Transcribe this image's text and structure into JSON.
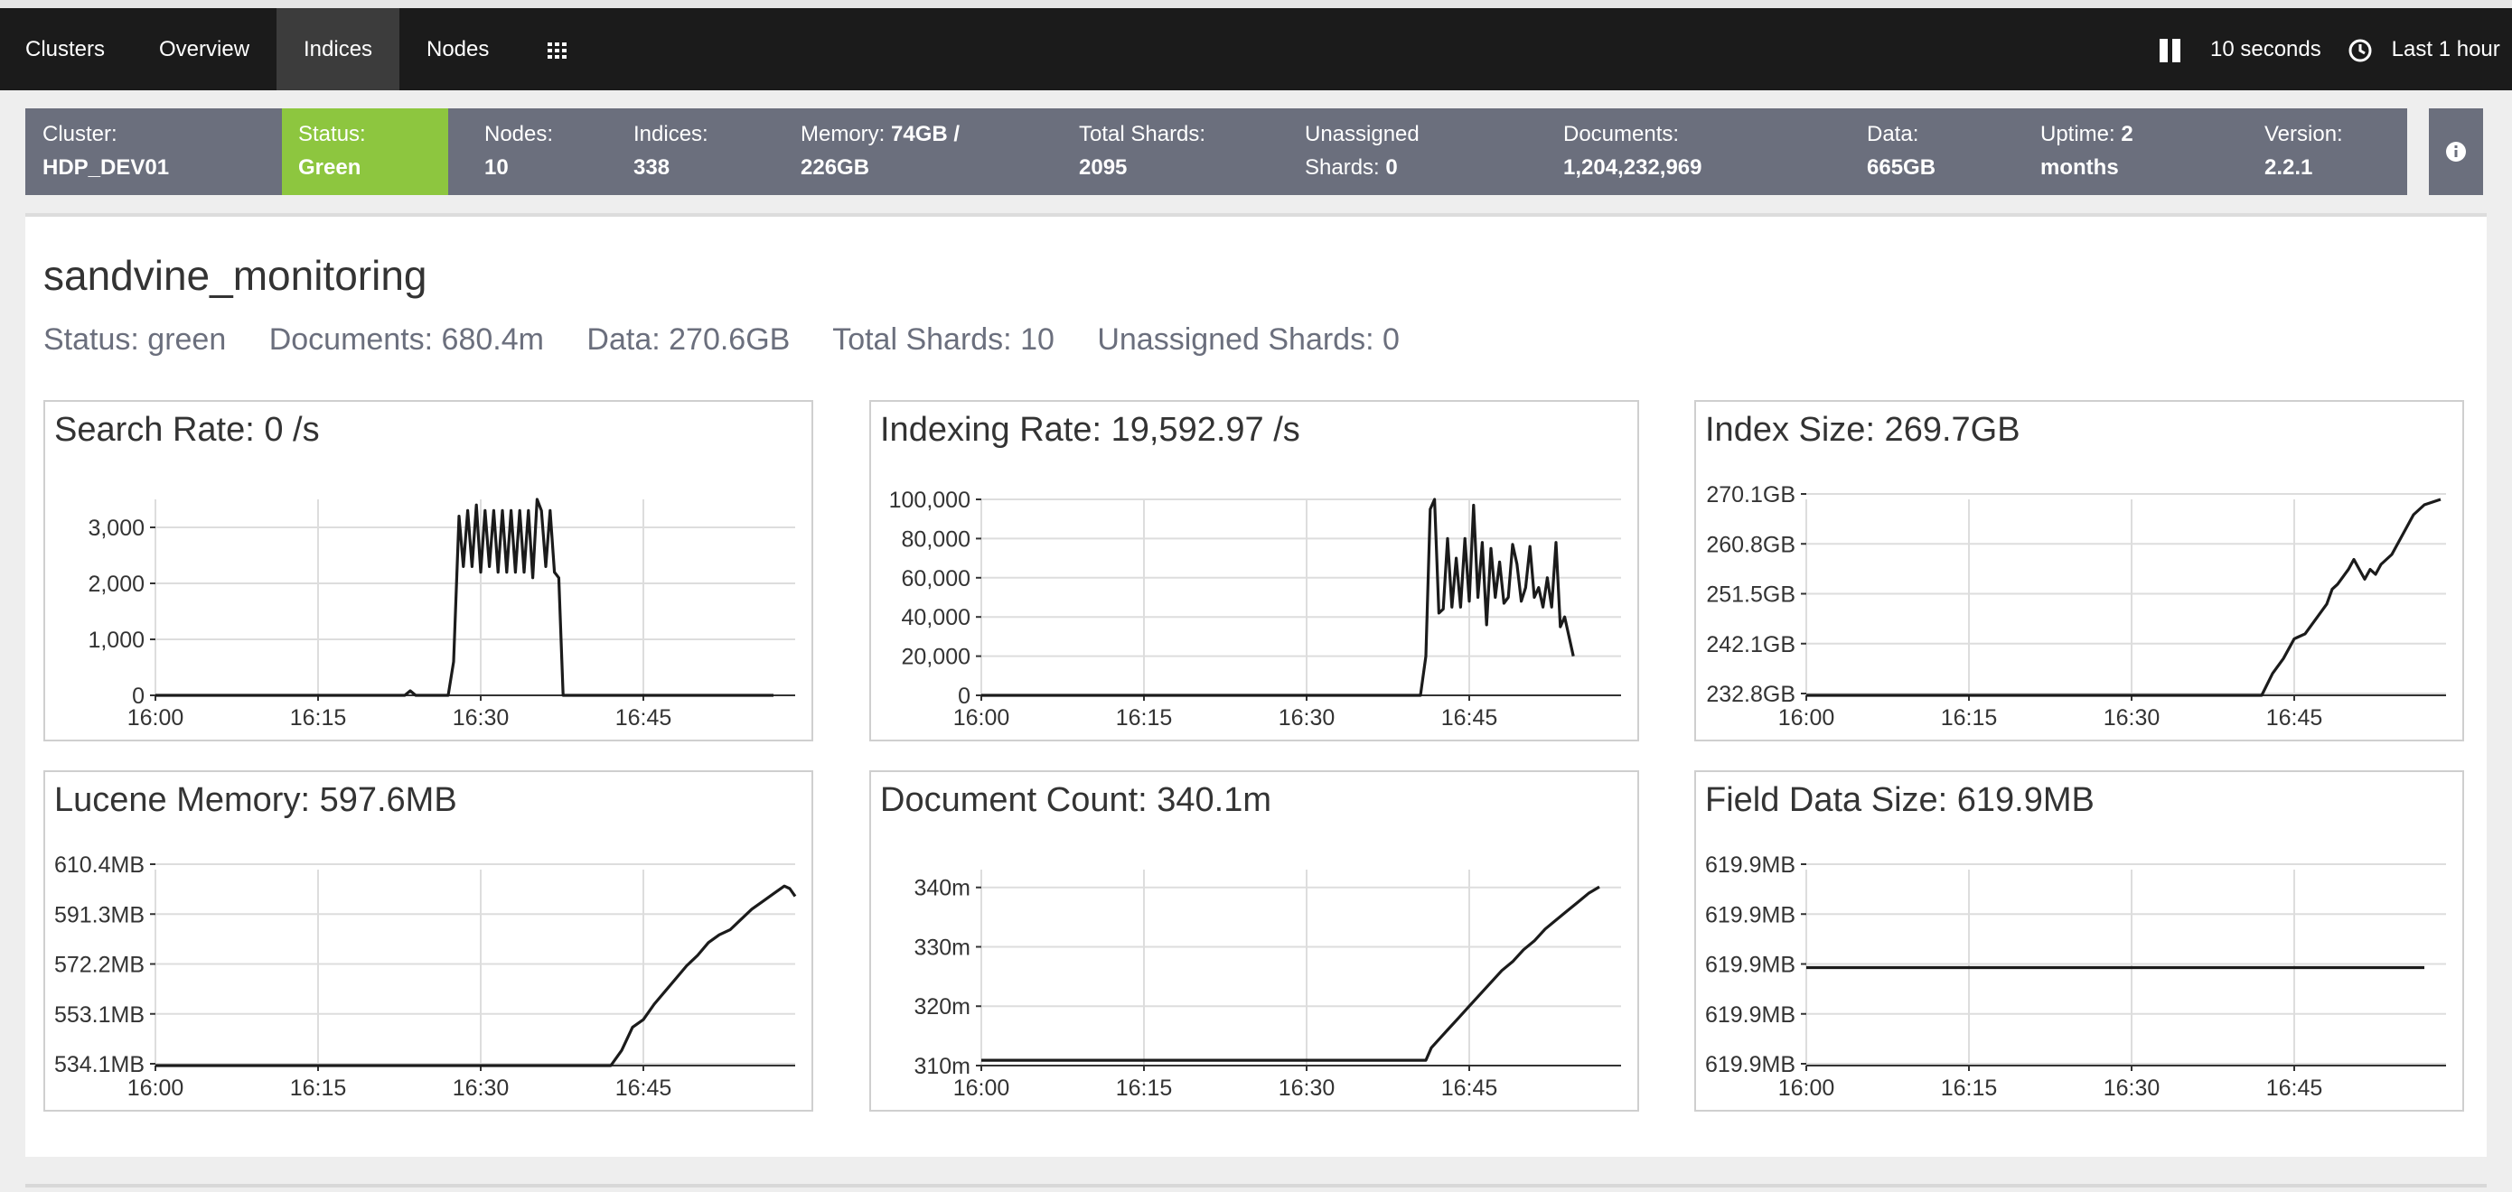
{
  "nav": {
    "tabs": [
      {
        "label": "Clusters"
      },
      {
        "label": "Overview"
      },
      {
        "label": "Indices",
        "active": true
      },
      {
        "label": "Nodes"
      }
    ],
    "grid_icon": "grid-icon",
    "refresh_label": "10 seconds",
    "time_label": "Last 1 hour",
    "pause_icon": "pause-icon",
    "clock_icon": "clock-icon"
  },
  "summary": {
    "cluster_label": "Cluster:",
    "cluster_value": "HDP_DEV01",
    "status_label": "Status:",
    "status_value": "Green",
    "nodes_label": "Nodes:",
    "nodes_value": "10",
    "indices_label": "Indices:",
    "indices_value": "338",
    "memory_label": "Memory:",
    "memory_value_line1": "74GB /",
    "memory_value_line2": "226GB",
    "shards_label": "Total Shards:",
    "shards_value": "2095",
    "unassigned_label_line1": "Unassigned",
    "unassigned_label_line2": "Shards:",
    "unassigned_value": "0",
    "documents_label": "Documents:",
    "documents_value": "1,204,232,969",
    "data_label": "Data:",
    "data_value": "665GB",
    "uptime_label": "Uptime:",
    "uptime_value_line1": "2",
    "uptime_value_line2": "months",
    "version_label": "Version:",
    "version_value": "2.2.1",
    "info_icon": "info-icon",
    "status_color": "#8dc63f",
    "bar_color": "#6b6f7d"
  },
  "index": {
    "name": "sandvine_monitoring",
    "status": "Status: green",
    "documents": "Documents: 680.4m",
    "data": "Data: 270.6GB",
    "total_shards": "Total Shards: 10",
    "unassigned_shards": "Unassigned Shards: 0"
  },
  "chart_data": [
    {
      "type": "line",
      "title": "Search Rate: 0 /s",
      "x_ticks": [
        "16:00",
        "16:15",
        "16:30",
        "16:45"
      ],
      "y_ticks": [
        "0",
        "1,000",
        "2,000",
        "3,000"
      ],
      "x_range_minutes": [
        0,
        57
      ],
      "y_range": [
        0,
        3500
      ],
      "series": [
        {
          "points": [
            [
              0,
              0
            ],
            [
              23,
              0
            ],
            [
              23.5,
              80
            ],
            [
              24,
              0
            ],
            [
              27,
              0
            ],
            [
              27.5,
              600
            ],
            [
              28,
              3200
            ],
            [
              28.4,
              2300
            ],
            [
              28.8,
              3300
            ],
            [
              29.2,
              2300
            ],
            [
              29.6,
              3400
            ],
            [
              30,
              2200
            ],
            [
              30.4,
              3300
            ],
            [
              30.8,
              2300
            ],
            [
              31.2,
              3300
            ],
            [
              31.6,
              2200
            ],
            [
              32,
              3300
            ],
            [
              32.4,
              2200
            ],
            [
              32.8,
              3300
            ],
            [
              33.2,
              2200
            ],
            [
              33.6,
              3300
            ],
            [
              34,
              2200
            ],
            [
              34.4,
              3300
            ],
            [
              34.8,
              2100
            ],
            [
              35.2,
              3500
            ],
            [
              35.6,
              3300
            ],
            [
              36,
              2300
            ],
            [
              36.4,
              3300
            ],
            [
              36.8,
              2200
            ],
            [
              37.2,
              2100
            ],
            [
              37.6,
              0
            ],
            [
              57,
              0
            ]
          ]
        }
      ]
    },
    {
      "type": "line",
      "title": "Indexing Rate: 19,592.97 /s",
      "x_ticks": [
        "16:00",
        "16:15",
        "16:30",
        "16:45"
      ],
      "y_ticks": [
        "0",
        "20,000",
        "40,000",
        "60,000",
        "80,000",
        "100,000"
      ],
      "x_range_minutes": [
        0,
        57
      ],
      "y_range": [
        0,
        100000
      ],
      "series": [
        {
          "points": [
            [
              0,
              0
            ],
            [
              40.5,
              0
            ],
            [
              41,
              20000
            ],
            [
              41.4,
              95000
            ],
            [
              41.8,
              100000
            ],
            [
              42.2,
              42000
            ],
            [
              42.6,
              44000
            ],
            [
              43,
              80000
            ],
            [
              43.4,
              45000
            ],
            [
              43.8,
              70000
            ],
            [
              44.2,
              45000
            ],
            [
              44.6,
              80000
            ],
            [
              45,
              48000
            ],
            [
              45.4,
              97000
            ],
            [
              45.8,
              50000
            ],
            [
              46.2,
              78000
            ],
            [
              46.6,
              36000
            ],
            [
              47,
              75000
            ],
            [
              47.4,
              50000
            ],
            [
              47.8,
              68000
            ],
            [
              48.2,
              47000
            ],
            [
              48.6,
              50000
            ],
            [
              49,
              77000
            ],
            [
              49.4,
              67000
            ],
            [
              49.8,
              48000
            ],
            [
              50.2,
              55000
            ],
            [
              50.6,
              76000
            ],
            [
              51,
              50000
            ],
            [
              51.4,
              55000
            ],
            [
              51.8,
              45000
            ],
            [
              52.2,
              60000
            ],
            [
              52.6,
              45000
            ],
            [
              53,
              78000
            ],
            [
              53.4,
              35000
            ],
            [
              53.8,
              40000
            ],
            [
              54.2,
              30000
            ],
            [
              54.6,
              20000
            ]
          ]
        }
      ]
    },
    {
      "type": "line",
      "title": "Index Size: 269.7GB",
      "x_ticks": [
        "16:00",
        "16:15",
        "16:30",
        "16:45"
      ],
      "y_ticks": [
        "232.8GB",
        "242.1GB",
        "251.5GB",
        "260.8GB",
        "270.1GB"
      ],
      "x_range_minutes": [
        0,
        57
      ],
      "y_range": [
        230.6,
        270.1
      ],
      "series": [
        {
          "points": [
            [
              0,
              230.6
            ],
            [
              42,
              230.6
            ],
            [
              43,
              235
            ],
            [
              44,
              238
            ],
            [
              45,
              242
            ],
            [
              46,
              243
            ],
            [
              47,
              246
            ],
            [
              48,
              249
            ],
            [
              48.5,
              252
            ],
            [
              49,
              253
            ],
            [
              50,
              256
            ],
            [
              50.5,
              258
            ],
            [
              51,
              256
            ],
            [
              51.5,
              254
            ],
            [
              52,
              256
            ],
            [
              52.5,
              255
            ],
            [
              53,
              257
            ],
            [
              54,
              259
            ],
            [
              54.5,
              261
            ],
            [
              55,
              263
            ],
            [
              55.5,
              265
            ],
            [
              56,
              267
            ],
            [
              57,
              269
            ],
            [
              58.5,
              270.1
            ]
          ]
        }
      ]
    },
    {
      "type": "line",
      "title": "Lucene Memory: 597.6MB",
      "x_ticks": [
        "16:00",
        "16:15",
        "16:30",
        "16:45"
      ],
      "y_ticks": [
        "534.1MB",
        "553.1MB",
        "572.2MB",
        "591.3MB",
        "610.4MB"
      ],
      "x_range_minutes": [
        0,
        57
      ],
      "y_range": [
        534.1,
        610.4
      ],
      "series": [
        {
          "points": [
            [
              0,
              534.1
            ],
            [
              42,
              534.1
            ],
            [
              43,
              540
            ],
            [
              44,
              549
            ],
            [
              45,
              552
            ],
            [
              46,
              558
            ],
            [
              47,
              563
            ],
            [
              48,
              568
            ],
            [
              49,
              573
            ],
            [
              50,
              577
            ],
            [
              51,
              582
            ],
            [
              52,
              585
            ],
            [
              53,
              587
            ],
            [
              54,
              591
            ],
            [
              55,
              595
            ],
            [
              56,
              598
            ],
            [
              57,
              601
            ],
            [
              58,
              604
            ],
            [
              58.5,
              603
            ],
            [
              59,
              600
            ]
          ]
        }
      ]
    },
    {
      "type": "line",
      "title": "Document Count: 340.1m",
      "x_ticks": [
        "16:00",
        "16:15",
        "16:30",
        "16:45"
      ],
      "y_ticks": [
        "310m",
        "320m",
        "330m",
        "340m"
      ],
      "x_range_minutes": [
        0,
        57
      ],
      "y_range": [
        310,
        343
      ],
      "series": [
        {
          "points": [
            [
              0,
              310.9
            ],
            [
              40.5,
              310.9
            ],
            [
              41,
              310.9
            ],
            [
              41.5,
              313
            ],
            [
              42,
              314
            ],
            [
              43,
              316
            ],
            [
              44,
              318
            ],
            [
              45,
              320
            ],
            [
              46,
              322
            ],
            [
              47,
              324
            ],
            [
              48,
              326
            ],
            [
              49,
              327.5
            ],
            [
              50,
              329.5
            ],
            [
              51,
              331
            ],
            [
              52,
              333
            ],
            [
              53,
              334.5
            ],
            [
              54,
              336
            ],
            [
              55,
              337.5
            ],
            [
              56,
              339
            ],
            [
              57,
              340.1
            ]
          ]
        }
      ]
    },
    {
      "type": "line",
      "title": "Field Data Size: 619.9MB",
      "x_ticks": [
        "16:00",
        "16:15",
        "16:30",
        "16:45"
      ],
      "y_ticks": [
        "619.9MB",
        "619.9MB",
        "619.9MB",
        "619.9MB",
        "619.9MB"
      ],
      "x_range_minutes": [
        0,
        57
      ],
      "y_range": [
        0,
        4
      ],
      "series": [
        {
          "points": [
            [
              0,
              2
            ],
            [
              57,
              2
            ]
          ]
        }
      ]
    }
  ]
}
